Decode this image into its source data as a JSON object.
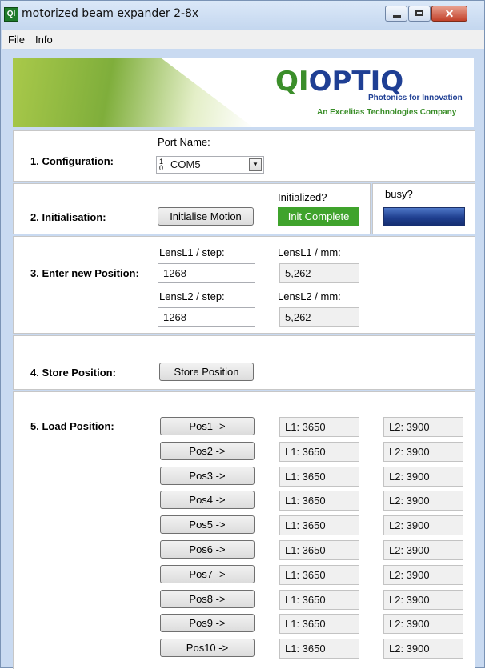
{
  "window": {
    "title": "motorized beam expander 2-8x",
    "icon_label": "QI",
    "close_glyph": "✕"
  },
  "menu": {
    "items": [
      "File",
      "Info"
    ]
  },
  "banner": {
    "logo": "QIOPTIQ",
    "tagline": "Photonics for Innovation",
    "company": "An Excelitas Technologies Company"
  },
  "configuration": {
    "section_label": "1. Configuration:",
    "port_label": "Port Name:",
    "port_value": "COM5",
    "arrow_glyph": "▼"
  },
  "initialisation": {
    "section_label": "2. Initialisation:",
    "button": "Initialise Motion",
    "initialized_label": "Initialized?",
    "status": "Init Complete",
    "busy_label": "busy?"
  },
  "position": {
    "section_label": "3. Enter new Position:",
    "lens1_step_label": "LensL1 / step:",
    "lens1_step": "1268",
    "lens1_mm_label": "LensL1 / mm:",
    "lens1_mm": "5,262",
    "lens2_step_label": "LensL2 / step:",
    "lens2_step": "1268",
    "lens2_mm_label": "LensL2 / mm:",
    "lens2_mm": "5,262"
  },
  "store": {
    "section_label": "4. Store Position:",
    "button": "Store Position"
  },
  "load": {
    "section_label": "5. Load Position:",
    "rows": [
      {
        "button": "Pos1 ->",
        "l1": "L1: 3650",
        "l2": "L2: 3900"
      },
      {
        "button": "Pos2 ->",
        "l1": "L1: 3650",
        "l2": "L2: 3900"
      },
      {
        "button": "Pos3 ->",
        "l1": "L1: 3650",
        "l2": "L2: 3900"
      },
      {
        "button": "Pos4 ->",
        "l1": "L1: 3650",
        "l2": "L2: 3900"
      },
      {
        "button": "Pos5 ->",
        "l1": "L1: 3650",
        "l2": "L2: 3900"
      },
      {
        "button": "Pos6 ->",
        "l1": "L1: 3650",
        "l2": "L2: 3900"
      },
      {
        "button": "Pos7 ->",
        "l1": "L1: 3650",
        "l2": "L2: 3900"
      },
      {
        "button": "Pos8 ->",
        "l1": "L1: 3650",
        "l2": "L2: 3900"
      },
      {
        "button": "Pos9 ->",
        "l1": "L1: 3650",
        "l2": "L2: 3900"
      },
      {
        "button": "Pos10 ->",
        "l1": "L1: 3650",
        "l2": "L2: 3900"
      }
    ]
  },
  "colors": {
    "logo_blue": "#1f3f94",
    "logo_green": "#3b8e2a",
    "init_green": "#3fa32c",
    "busy_blue": "#1f3f8f"
  }
}
